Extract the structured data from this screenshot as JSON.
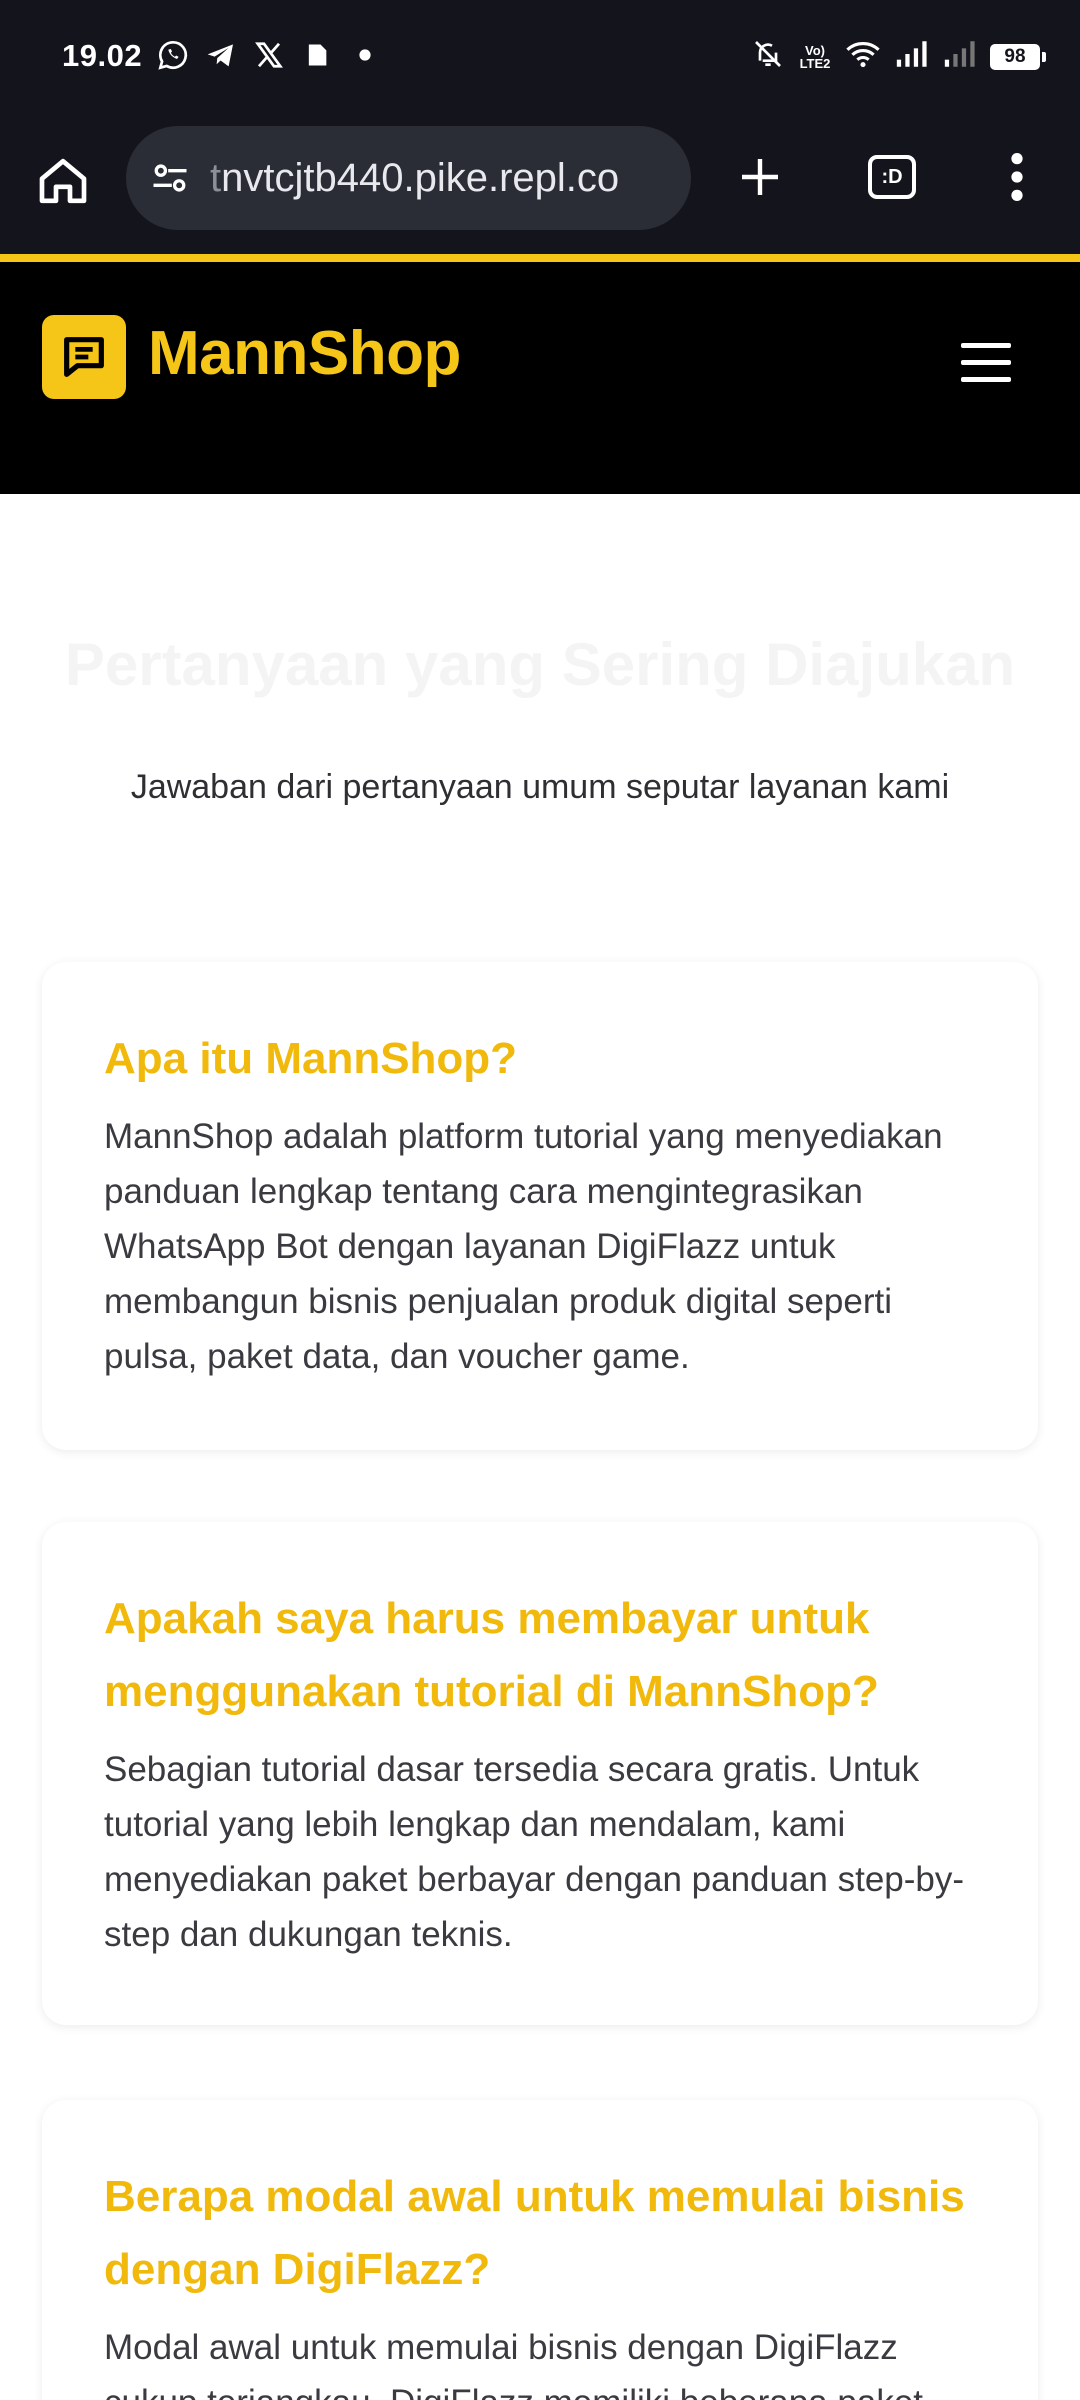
{
  "status_bar": {
    "time": "19.02",
    "battery": "98",
    "network_label": "Vo) LTE2"
  },
  "browser": {
    "url_faded": "t",
    "url_main": "nvtcjtb440.pike.repl.co",
    "tabs_label": ":D"
  },
  "site": {
    "brand": "MannShop",
    "accent_color": "#f5c518"
  },
  "faq": {
    "title": "Pertanyaan yang Sering Diajukan",
    "subtitle": "Jawaban dari pertanyaan umum seputar layanan kami",
    "items": [
      {
        "question": "Apa itu MannShop?",
        "answer": "MannShop adalah platform tutorial yang menyediakan panduan lengkap tentang cara mengintegrasikan WhatsApp Bot dengan layanan DigiFlazz untuk membangun bisnis penjualan produk digital seperti pulsa, paket data, dan voucher game."
      },
      {
        "question": "Apakah saya harus membayar untuk menggunakan tutorial di MannShop?",
        "answer": "Sebagian tutorial dasar tersedia secara gratis. Untuk tutorial yang lebih lengkap dan mendalam, kami menyediakan paket berbayar dengan panduan step-by-step dan dukungan teknis."
      },
      {
        "question": "Berapa modal awal untuk memulai bisnis dengan DigiFlazz?",
        "answer": "Modal awal untuk memulai bisnis dengan DigiFlazz cukup terjangkau. DigiFlazz memiliki beberapa paket"
      }
    ]
  }
}
